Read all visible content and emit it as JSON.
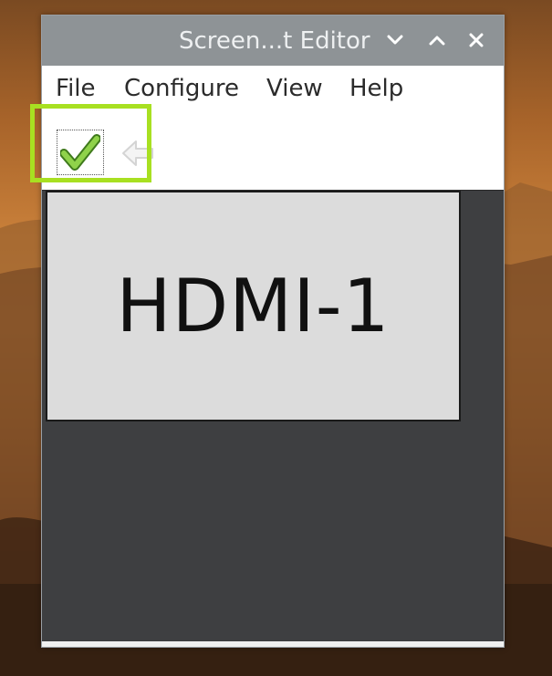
{
  "window": {
    "title": "Screen...t Editor"
  },
  "titlebar": {
    "minimize_icon": "chevron-down-icon",
    "maximize_icon": "chevron-up-icon",
    "close_icon": "close-icon"
  },
  "menu": {
    "items": [
      {
        "label": "File"
      },
      {
        "label": "Configure"
      },
      {
        "label": "View"
      },
      {
        "label": "Help"
      }
    ]
  },
  "toolbar": {
    "apply_icon": "checkmark-icon",
    "back_icon": "back-arrow-icon"
  },
  "layout_canvas": {
    "display_name": "HDMI-1"
  },
  "colors": {
    "titlebar_bg": "#8e9396",
    "highlight": "#a8e021",
    "canvas_bg": "#3e3f41",
    "display_bg": "#dcdcdc",
    "apply_green": "#7cc242"
  }
}
